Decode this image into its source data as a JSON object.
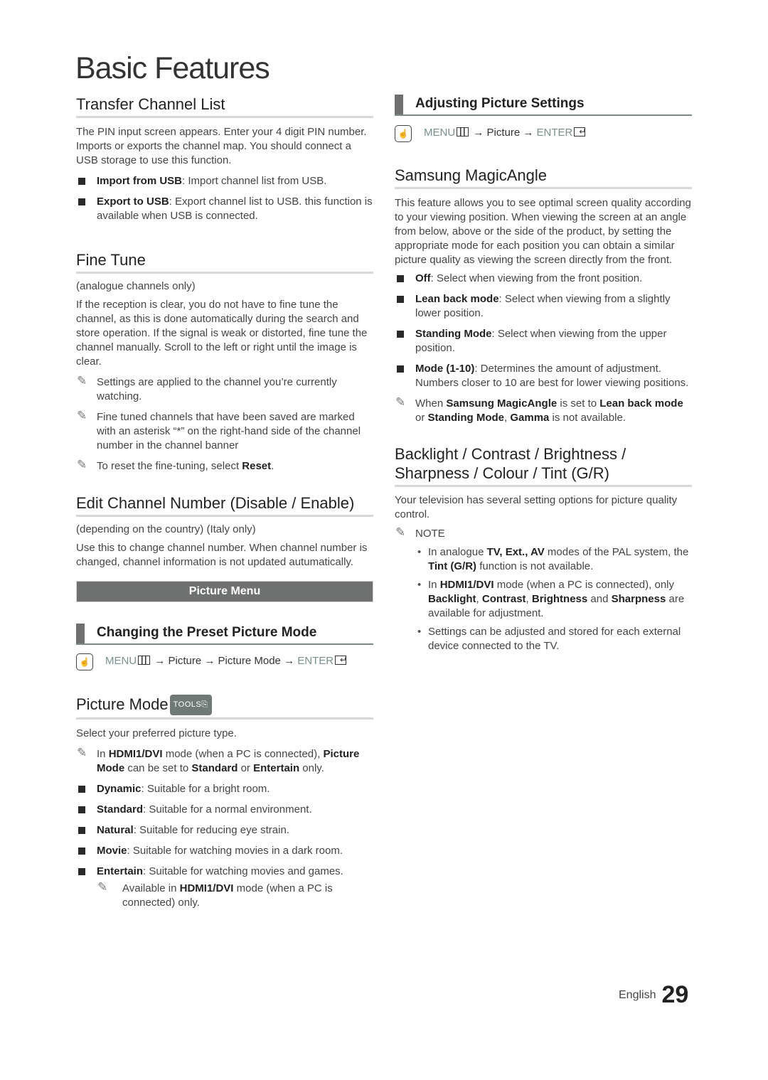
{
  "page_title": "Basic Features",
  "left": {
    "transfer": {
      "heading": "Transfer Channel List",
      "body": "The PIN input screen appears. Enter your 4 digit PIN number. Imports or exports the channel map. You should connect a USB storage to use this function.",
      "bullets": [
        {
          "term": "Import from USB",
          "text": ": Import channel list from USB."
        },
        {
          "term": "Export to USB",
          "text": ": Export channel list to USB. this function is available when USB is connected."
        }
      ]
    },
    "fine_tune": {
      "heading": "Fine Tune",
      "qualifier": "(analogue channels only)",
      "body": "If the reception is clear, you do not have to fine tune the channel, as this is done automatically during the search and store operation. If the signal is weak or distorted, fine tune the channel manually. Scroll to the left or right until the image is clear.",
      "notes": [
        "Settings are applied to the channel you’re currently watching.",
        "Fine tuned channels that have been saved are marked with an asterisk “*” on the right-hand side of the channel number in the channel banner"
      ],
      "note3_pre": "To reset the fine-tuning, select ",
      "note3_term": "Reset",
      "note3_post": "."
    },
    "edit_channel": {
      "heading": "Edit Channel Number (Disable / Enable)",
      "qualifier": "(depending on the country) (Italy only)",
      "body": "Use this to change channel number. When channel number is changed, channel information is not updated autumatically."
    },
    "banner": "Picture Menu",
    "preset": {
      "heading": "Changing the Preset Picture Mode",
      "menu": "MENU",
      "arrow1": " → Picture → Picture Mode → ",
      "enter": "ENTER"
    },
    "picture_mode": {
      "heading": "Picture Mode",
      "tools_badge": "TOOLS⎘",
      "body": "Select your preferred picture type.",
      "note_parts": [
        "In ",
        "HDMI1/DVI",
        " mode (when a PC is connected), ",
        "Picture Mode",
        " can be set to ",
        "Standard",
        " or ",
        "Entertain",
        " only."
      ],
      "bullets": [
        {
          "term": "Dynamic",
          "text": ": Suitable for a bright room."
        },
        {
          "term": "Standard",
          "text": ": Suitable for a normal environment."
        },
        {
          "term": "Natural",
          "text": ": Suitable for reducing eye strain."
        },
        {
          "term": "Movie",
          "text": ": Suitable for watching movies in a dark room."
        },
        {
          "term": "Entertain",
          "text": ": Suitable for watching movies and games."
        }
      ],
      "sub_note_parts": [
        "Available in ",
        "HDMI1/DVI",
        " mode (when a PC is connected) only."
      ]
    }
  },
  "right": {
    "adjusting": {
      "heading": "Adjusting Picture Settings",
      "menu": "MENU",
      "arrow1": " → Picture → ",
      "enter": "ENTER"
    },
    "magic_angle": {
      "heading": "Samsung MagicAngle",
      "body": "This feature allows you to see optimal screen quality according to your viewing position. When viewing the screen at an angle from below, above or the side of the product, by setting the appropriate mode for each position you can obtain a similar picture quality as viewing the screen directly from the front.",
      "bullets": [
        {
          "term": "Off",
          "text": ": Select when viewing from the front position."
        },
        {
          "term": "Lean back mode",
          "text": ": Select when viewing from a slightly lower position."
        },
        {
          "term": "Standing Mode",
          "text": ": Select when viewing from the upper position."
        },
        {
          "term": "Mode (1-10)",
          "text": ": Determines the amount of adjustment. Numbers closer to 10 are best for lower viewing positions."
        }
      ],
      "note_parts": [
        "When ",
        "Samsung MagicAngle",
        " is set to ",
        "Lean back mode",
        " or ",
        "Standing Mode",
        ", ",
        "Gamma",
        " is not available."
      ]
    },
    "backlight": {
      "heading_line1": "Backlight / Contrast / Brightness /",
      "heading_line2": "Sharpness / Colour / Tint (G/R)",
      "body": "Your television has several setting options for picture quality control.",
      "note_label": "NOTE",
      "dot1_parts": [
        "In analogue ",
        "TV, Ext., AV",
        " modes of the PAL system, the ",
        "Tint (G/R)",
        " function is not available."
      ],
      "dot2_parts": [
        "In ",
        "HDMI1/DVI",
        " mode (when a PC is connected), only ",
        "Backlight",
        ", ",
        "Contrast",
        ", ",
        "Brightness",
        " and ",
        "Sharpness",
        " are available for adjustment."
      ],
      "dot3": "Settings can be adjusted and stored for each external device connected to the TV."
    }
  },
  "footer": {
    "language": "English",
    "page_number": "29"
  }
}
